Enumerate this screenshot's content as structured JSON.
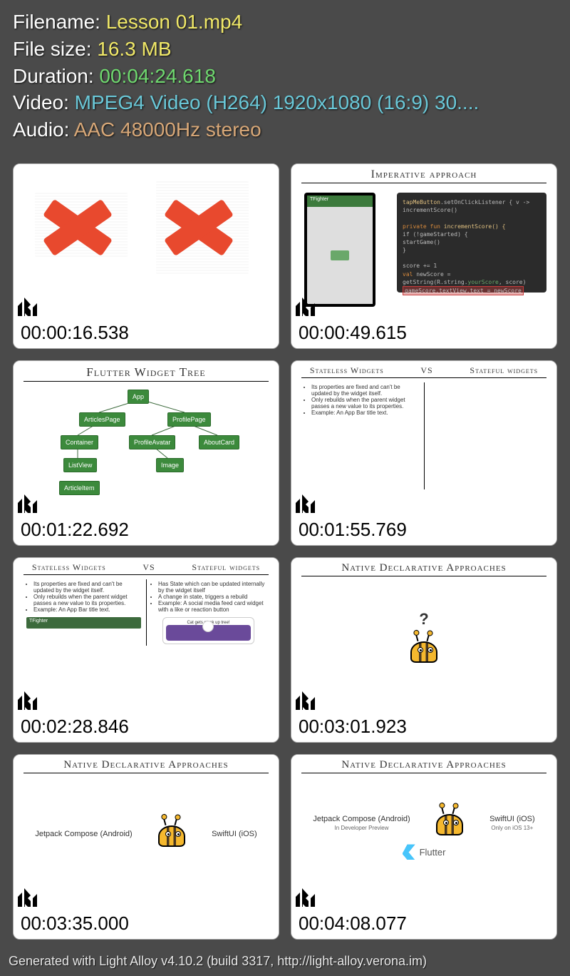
{
  "header": {
    "filename_label": "Filename: ",
    "filename_value": "Lesson 01.mp4",
    "filesize_label": "File size: ",
    "filesize_value": "16.3 MB",
    "duration_label": "Duration: ",
    "duration_value": "00:04:24.618",
    "video_label": "Video: ",
    "video_value": "MPEG4 Video (H264) 1920x1080 (16:9) 30....",
    "audio_label": "Audio: ",
    "audio_value": "AAC 48000Hz stereo"
  },
  "thumbs": [
    {
      "ts": "00:00:16.538"
    },
    {
      "ts": "00:00:49.615",
      "title": "Imperative approach",
      "phone_title": "TFighter",
      "code_l1a": "tapMeButton",
      "code_l1b": ".setOnClickListener { v ->",
      "code_l2": "  incrementScore()",
      "code_l3a": "private fun ",
      "code_l3b": "incrementScore() {",
      "code_l4": "  if (!gameStarted) {",
      "code_l5": "    startGame()",
      "code_l6": "  }",
      "code_l7": "  score += 1",
      "code_l8a": "  val ",
      "code_l8b": "newScore = getString(R.string.",
      "code_l8c": "yourScore",
      "code_l8d": ", score)",
      "code_l9": "  gameScore.textView.text = newScore"
    },
    {
      "ts": "00:01:22.692",
      "title": "Flutter Widget Tree",
      "tree": {
        "app": "App",
        "articlesPage": "ArticlesPage",
        "profilePage": "ProfilePage",
        "container": "Container",
        "profileAvatar": "ProfileAvatar",
        "aboutCard": "AboutCard",
        "listView": "ListView",
        "image": "Image",
        "articleItem": "ArticleItem"
      }
    },
    {
      "ts": "00:01:55.769",
      "title_l": "Stateless Widgets",
      "title_m": "VS",
      "title_r": "Stateful widgets",
      "b1": "Its properties are fixed and can't be updated by the widget itself.",
      "b2": "Only rebuilds when the parent widget passes a new value to its properties.",
      "b3": "Example: An App Bar title text."
    },
    {
      "ts": "00:02:28.846",
      "title_l": "Stateless Widgets",
      "title_m": "VS",
      "title_r": "Stateful widgets",
      "l1": "Its properties are fixed and can't be updated by the widget itself.",
      "l2": "Only rebuilds when the parent widget passes a new value to its properties.",
      "l3": "Example: An App Bar title text.",
      "r1": "Has State which can be updated internally by the widget itself",
      "r2": "A change in state, triggers a rebuild",
      "r3": "Example: A social media feed card widget with a like or reaction button",
      "barText": "TFighter",
      "cardText": "Cat gets stuck up tree!"
    },
    {
      "ts": "00:03:01.923",
      "title": "Native Declarative Approaches",
      "q": "?"
    },
    {
      "ts": "00:03:35.000",
      "title": "Native Declarative Approaches",
      "left": "Jetpack Compose (Android)",
      "right": "SwiftUI (iOS)"
    },
    {
      "ts": "00:04:08.077",
      "title": "Native Declarative Approaches",
      "left": "Jetpack Compose (Android)",
      "left_sub": "In Developer Preview",
      "right": "SwiftUI (iOS)",
      "right_sub": "Only on iOS 13+",
      "flutter": "Flutter"
    }
  ],
  "footer": "Generated with Light Alloy v4.10.2 (build 3317, http://light-alloy.verona.im)"
}
